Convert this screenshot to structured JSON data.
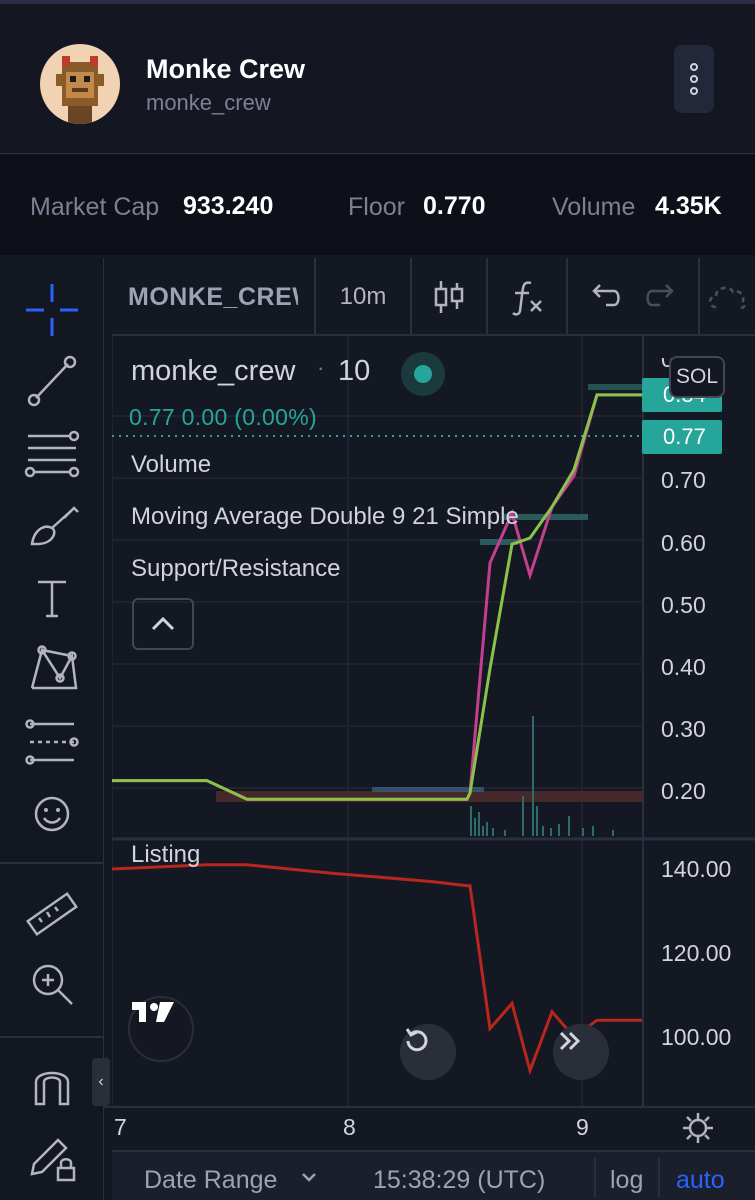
{
  "profile": {
    "name": "Monke Crew",
    "handle": "monke_crew",
    "avatar_icon": "pixel-monkey-avatar",
    "menu_icon": "vertical-dots-icon"
  },
  "stats": [
    {
      "label": "Market Cap",
      "value": "933.240"
    },
    {
      "label": "Floor",
      "value": "0.770"
    },
    {
      "label": "Volume",
      "value": "4.35K"
    }
  ],
  "toolbar": {
    "symbol": "MONKE_CREW",
    "interval": "10m",
    "icons": [
      "candles-icon",
      "fx-icon",
      "undo-icon",
      "redo-icon",
      "cloud-icon"
    ]
  },
  "left_tools": [
    "crosshair-icon",
    "trend-line-icon",
    "fib-lines-icon",
    "brush-icon",
    "text-icon",
    "pattern-icon",
    "prediction-icon",
    "emoji-icon",
    "ruler-icon",
    "zoom-in-icon",
    "magnet-icon",
    "lock-pencil-icon"
  ],
  "legend": {
    "title": "monke_crew",
    "separator": "·",
    "interval": "10",
    "values": "0.77 0.00 (0.00%)",
    "indicators": [
      "Volume",
      "Moving Average Double 9 21 Simple",
      "Support/Resistance"
    ]
  },
  "price_axis": {
    "ticks": [
      "0.70",
      "0.60",
      "0.50",
      "0.40",
      "0.30",
      "0.20"
    ],
    "tags": {
      "sma": "0.84",
      "last": "0.77"
    },
    "currency": "SOL"
  },
  "listing": {
    "label": "Listing",
    "ticks": [
      "140.00",
      "120.00",
      "100.00"
    ]
  },
  "time_axis": {
    "ticks": [
      "7",
      "8",
      "9"
    ]
  },
  "bottom_bar": {
    "date_range": "Date Range",
    "time": "15:38:29 (UTC)",
    "log": "log",
    "auto": "auto"
  },
  "colors": {
    "up": "#26a69a",
    "ma_fast": "#c2408f",
    "ma_slow": "#8bc34a",
    "listing_line": "#b8261c",
    "accent_blue": "#2962ff"
  },
  "chart_data": {
    "type": "line",
    "x_ticks": [
      "7",
      "8",
      "9"
    ],
    "ylim": [
      0.15,
      0.9
    ],
    "series": [
      {
        "values": [
          0.22,
          0.22,
          0.19,
          0.19,
          0.19,
          0.19,
          0.2,
          0.57,
          0.65,
          0.55,
          0.66,
          0.71,
          0.84,
          0.84
        ]
      },
      {
        "values": [
          0.22,
          0.22,
          0.19,
          0.19,
          0.19,
          0.19,
          0.2,
          0.4,
          0.6,
          0.61,
          0.66,
          0.72,
          0.84,
          0.84
        ]
      }
    ],
    "listing": {
      "ticks": [
        "140.00",
        "120.00",
        "100.00"
      ],
      "values": [
        140,
        141,
        141,
        139,
        137,
        136,
        136,
        102,
        108,
        92,
        106,
        100,
        104,
        104
      ]
    }
  }
}
